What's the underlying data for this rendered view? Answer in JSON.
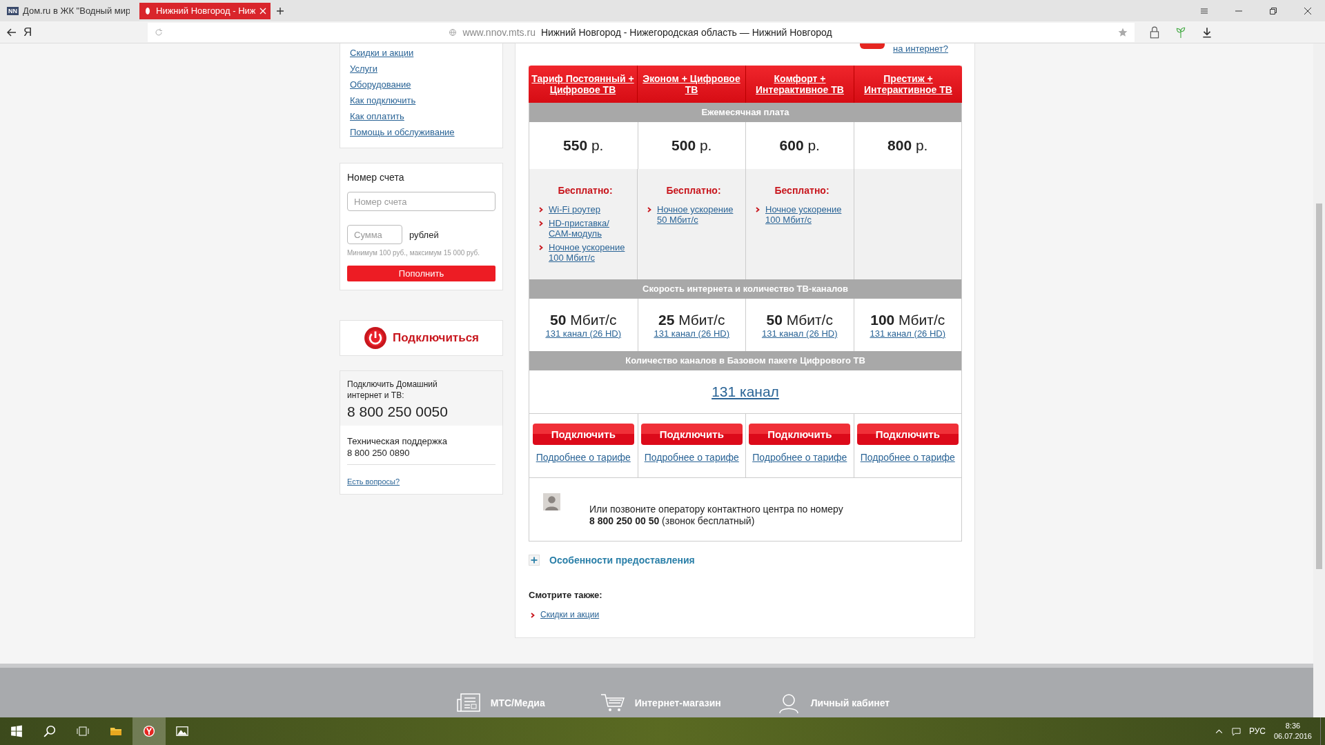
{
  "browser": {
    "tabs": [
      {
        "favicon_text": "NN",
        "title": "Дом.ru в ЖК \"Водный мир",
        "selected": false
      },
      {
        "title": "Нижний Новгород - Ниж",
        "selected": true
      }
    ],
    "logo": "Я",
    "domain": "www.nnov.mts.ru",
    "page_title": "Нижний Новгород - Нижегородская область — Нижний Новгород"
  },
  "sidebar": {
    "nav": [
      "Скидки и акции",
      "Услуги",
      "Оборудование",
      "Как подключить",
      "Как оплатить",
      "Помощь и обслуживание"
    ],
    "account": {
      "title": "Номер счета",
      "account_placeholder": "Номер счета",
      "sum_placeholder": "Сумма",
      "currency": "рублей",
      "hint": "Минимум 100 руб., максимум 15 000 руб.",
      "button": "Пополнить"
    },
    "connect": "Подключиться",
    "contacts": {
      "connect_label": "Подключить Домашний интернет и ТВ:",
      "connect_phone": "8 800 250 0050",
      "support_label": "Техническая поддержка",
      "support_phone": "8 800 250 0890",
      "questions_link": "Есть вопросы?"
    }
  },
  "top_link": "на интернет?",
  "tariffs": {
    "headers": [
      "Ежемесячная плата",
      "Скорость интернета и количество ТВ-каналов",
      "Количество каналов в Базовом пакете Цифрового ТВ"
    ],
    "plans": [
      {
        "name": "Тариф Постоянный + Цифровое ТВ",
        "price": "**550** р.",
        "free_label": "Бесплатно:",
        "free_items": [
          "Wi-Fi роутер",
          "HD-приставка/ САМ-модуль",
          "Ночное ускорение 100 Мбит/с"
        ],
        "speed": "**50** Мбит/с",
        "channels": "131 канал (26 HD)",
        "button": "Подключить",
        "details": "Подробнее о тарифе"
      },
      {
        "name": "Эконом + Цифровое ТВ",
        "price": "**500** р.",
        "free_label": "Бесплатно:",
        "free_items": [
          "Ночное ускорение 50 Мбит/с"
        ],
        "speed": "**25** Мбит/с",
        "channels": "131 канал (26 HD)",
        "button": "Подключить",
        "details": "Подробнее о тарифе"
      },
      {
        "name": "Комфорт + Интерактивное ТВ",
        "price": "**600** р.",
        "free_label": "Бесплатно:",
        "free_items": [
          "Ночное ускорение 100 Мбит/с"
        ],
        "speed": "**50** Мбит/с",
        "channels": "131 канал (26 HD)",
        "button": "Подключить",
        "details": "Подробнее о тарифе"
      },
      {
        "name": "Престиж + Интерактивное ТВ",
        "price": "**800** р.",
        "speed": "**100** Мбит/с",
        "channels": "131 канал (26 HD)",
        "button": "Подключить",
        "details": "Подробнее о тарифе"
      }
    ],
    "base_channels": "131 канал",
    "contact_text": "Или позвоните оператору контактного центра по номеру",
    "contact_phone": "**8 800 250 00 50** (звонок бесплатный)"
  },
  "features": {
    "title": "Особенности предоставления",
    "expanded": false
  },
  "see_also": {
    "title": "Смотрите также:",
    "links": [
      "Скидки и акции"
    ]
  },
  "footer": [
    {
      "kind": "media",
      "label": "МТС/Медиа"
    },
    {
      "kind": "shop",
      "label": "Интернет-магазин"
    },
    {
      "kind": "account",
      "label": "Личный кабинет"
    }
  ],
  "taskbar": {
    "apps": [
      {
        "kind": "search",
        "active": false
      },
      {
        "kind": "taskview",
        "active": false
      },
      {
        "kind": "explorer",
        "active": false
      },
      {
        "kind": "browser",
        "active": true
      },
      {
        "kind": "photos",
        "active": false
      }
    ],
    "lang": "РУС",
    "time": "8:36",
    "date": "06.07.2016"
  }
}
